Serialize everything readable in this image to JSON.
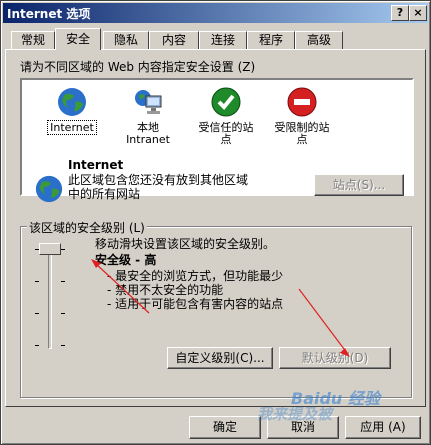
{
  "window": {
    "title": "Internet 选项",
    "help_button": "?",
    "close_button": "×"
  },
  "tabs": [
    "常规",
    "安全",
    "隐私",
    "内容",
    "连接",
    "程序",
    "高级"
  ],
  "active_tab": "安全",
  "security": {
    "zones_prompt": "请为不同区域的 Web 内容指定安全设置 (Z)",
    "zones": [
      {
        "label": "Internet",
        "icon": "globe-icon"
      },
      {
        "label": "本地\nIntranet",
        "icon": "intranet-icon"
      },
      {
        "label": "受信任的站\n点",
        "icon": "trusted-check-icon"
      },
      {
        "label": "受限制的站\n点",
        "icon": "restricted-icon"
      }
    ],
    "selected_zone": {
      "name": "Internet",
      "description_line1": "此区域包含您还没有放到其他区域",
      "description_line2": "中的所有网站",
      "sites_button": "站点(S)..."
    },
    "level_group_title": "该区域的安全级别 (L)",
    "slider_hint": "移动滑块设置该区域的安全级别。",
    "level_title": "安全级 - 高",
    "level_bullets": [
      "- 最安全的浏览方式，但功能最少",
      "- 禁用不太安全的功能",
      "- 适用于可能包含有害内容的站点"
    ],
    "custom_level_button": "自定义级别(C)...",
    "default_level_button": "默认级别(D)",
    "slider_level": 1.0
  },
  "footer": {
    "ok": "确定",
    "cancel": "取消",
    "apply": "应用 (A)"
  },
  "watermark": {
    "brand": "Baidu 经验",
    "sub": "我来提及被"
  },
  "colors": {
    "title_start": "#0a246a",
    "title_end": "#a6caf0",
    "face": "#d4d0c8",
    "annotation": "#e02020"
  }
}
